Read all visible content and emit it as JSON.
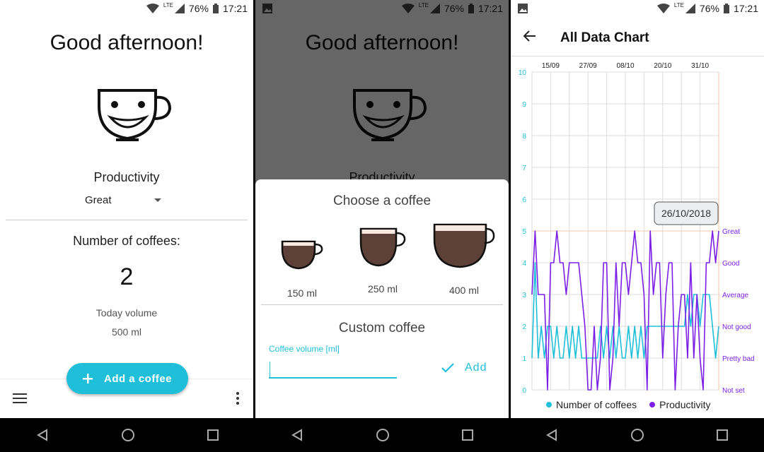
{
  "status_bar": {
    "network": "LTE",
    "battery": "76%",
    "time": "17:21",
    "icons": [
      "wifi-icon",
      "signal-icon",
      "battery-icon",
      "image-notification-icon"
    ]
  },
  "home": {
    "greeting": "Good afternoon!",
    "productivity_label": "Productivity",
    "productivity_value": "Great",
    "coffees_label": "Number of coffees:",
    "coffees_count": "2",
    "today_volume_label": "Today volume",
    "today_volume_value": "500 ml",
    "fab_label": "Add a coffee"
  },
  "dialog": {
    "title": "Choose a coffee",
    "options": [
      {
        "label": "150 ml"
      },
      {
        "label": "250 ml"
      },
      {
        "label": "400 ml"
      }
    ],
    "custom_title": "Custom coffee",
    "field_label": "Coffee volume [ml]",
    "field_value": "",
    "add_label": "Add"
  },
  "chart_screen": {
    "title": "All Data Chart",
    "tooltip": "26/10/2018"
  },
  "colors": {
    "accent": "#1fbfd9",
    "productivity": "#7b1fe6",
    "coffee_fill": "#5d4037",
    "highlight": "#f3c9a4"
  },
  "chart_data": {
    "type": "line",
    "top_tick_labels": [
      "15/09",
      "27/09",
      "08/10",
      "20/10",
      "31/10"
    ],
    "left_ticks": [
      "0",
      "1",
      "2",
      "3",
      "4",
      "5",
      "6",
      "7",
      "8",
      "9",
      "10"
    ],
    "right_ticks": [
      "Not set",
      "Pretty bad",
      "Not good",
      "Average",
      "Good",
      "Great"
    ],
    "ylim": [
      0,
      10
    ],
    "grid": true,
    "legend_position": "bottom",
    "highlight_index": 60,
    "series": [
      {
        "name": "Number of coffees",
        "color": "#1fbfd9",
        "values": [
          1,
          4,
          1,
          2,
          1,
          2,
          2,
          1,
          2,
          1,
          1,
          2,
          1,
          2,
          1,
          2,
          1,
          1,
          1,
          1,
          1,
          1,
          2,
          1,
          2,
          1,
          2,
          1,
          2,
          1,
          1,
          2,
          1,
          2,
          1,
          2,
          1,
          2,
          2,
          2,
          2,
          2,
          2,
          2,
          2,
          2,
          2,
          2,
          2,
          2,
          3,
          2,
          3,
          3,
          2,
          3,
          3,
          3,
          2,
          1,
          2
        ]
      },
      {
        "name": "Productivity",
        "color": "#7b1fe6",
        "values": [
          3,
          5,
          3,
          3,
          3,
          0,
          4,
          4,
          5,
          4,
          4,
          3,
          4,
          4,
          4,
          4,
          3,
          2,
          0,
          0,
          2,
          0,
          1,
          4,
          4,
          0,
          1,
          4,
          2,
          4,
          4,
          3,
          4,
          5,
          4,
          4,
          3,
          0,
          5,
          3,
          4,
          4,
          1,
          3,
          4,
          4,
          0,
          2,
          3,
          3,
          1,
          4,
          1,
          3,
          1,
          0,
          4,
          4,
          5,
          4,
          5
        ]
      }
    ]
  }
}
